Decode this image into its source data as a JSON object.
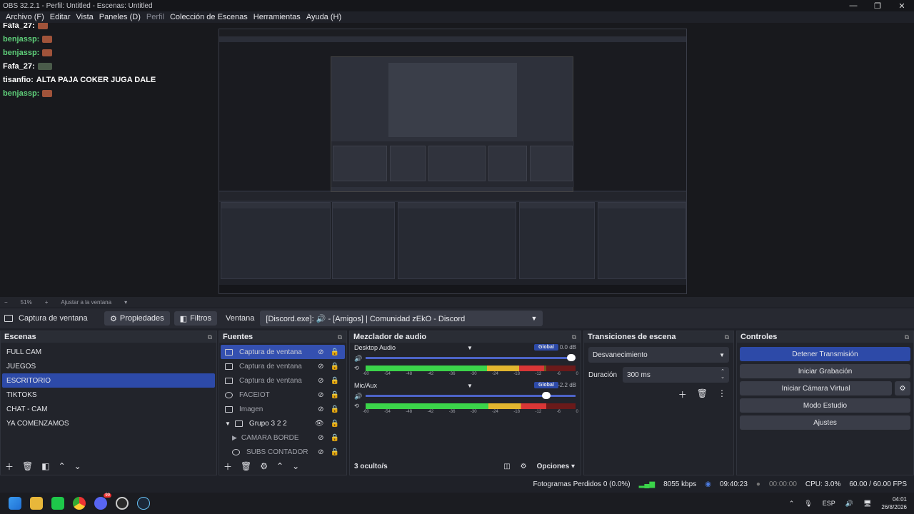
{
  "window": {
    "title": "OBS 32.2.1 - Perfil: Untitled - Escenas: Untitled"
  },
  "menu": {
    "items": [
      "Archivo (F)",
      "Editar",
      "Vista",
      "Paneles (D)",
      "Perfil",
      "Colección de Escenas",
      "Herramientas",
      "Ayuda (H)"
    ],
    "disabled_index": 4
  },
  "chat": {
    "lines": [
      {
        "user": "Fafa_27:",
        "color": "white",
        "text": "",
        "emote": "red",
        "badge": true
      },
      {
        "user": "benjassp:",
        "color": "green",
        "text": "",
        "emote": "red"
      },
      {
        "user": "benjassp:",
        "color": "green",
        "text": "",
        "emote": "red"
      },
      {
        "user": "Fafa_27:",
        "color": "white",
        "text": "",
        "emote": "dark",
        "badge": true
      },
      {
        "user": "tisanfio:",
        "color": "white",
        "text": "ALTA PAJA COKER JUGA DALE",
        "emote": ""
      },
      {
        "user": "benjassp:",
        "color": "green",
        "text": "",
        "emote": "red"
      }
    ]
  },
  "zoombar": {
    "minus": "−",
    "zoom": "51%",
    "plus": "+",
    "fit": "Ajustar a la ventana",
    "dropdown": "▾"
  },
  "context": {
    "source_name": "Captura de ventana",
    "properties": "Propiedades",
    "filters": "Filtros",
    "window_label": "Ventana",
    "window_value": "[Discord.exe]: 🔊 - [Amigos] | Comunidad zEkO - Discord"
  },
  "scenes": {
    "title": "Escenas",
    "items": [
      "FULL CAM",
      "JUEGOS",
      "ESCRITORIO",
      "TIKTOKS",
      "CHAT - CAM",
      "YA COMENZAMOS"
    ],
    "active_index": 2
  },
  "sources": {
    "title": "Fuentes",
    "items": [
      {
        "name": "Captura de ventana",
        "icon": "window-icon",
        "active": true
      },
      {
        "name": "Captura de ventana",
        "icon": "window-icon",
        "active": false
      },
      {
        "name": "Captura de ventana",
        "icon": "window-icon",
        "active": false
      },
      {
        "name": "FACEIOT",
        "icon": "globe-icon",
        "active": false
      },
      {
        "name": "Imagen",
        "icon": "image-icon",
        "active": false
      },
      {
        "name": "Grupo 3 2 2",
        "icon": "folder-icon",
        "active": false,
        "visible": true
      },
      {
        "name": "CAMARA BORDE",
        "icon": "play-icon",
        "active": false
      },
      {
        "name": "SUBS CONTADOR",
        "icon": "globe-icon",
        "active": false
      }
    ]
  },
  "mixer": {
    "title": "Mezclador de audio",
    "tracks": [
      {
        "name": "Desktop Audio",
        "db": "0.0 dB",
        "volume": 1.0,
        "level": 0.85,
        "global": "Global"
      },
      {
        "name": "Mic/Aux",
        "db": "-2.2 dB",
        "volume": 0.88,
        "level": 0.86,
        "global": "Global"
      }
    ],
    "ticks": [
      "-60",
      "-54",
      "-48",
      "-42",
      "-36",
      "-30",
      "-24",
      "-18",
      "-12",
      "-6",
      "0"
    ],
    "hidden_count": "3 oculto/s",
    "options": "Opciones"
  },
  "transitions": {
    "title": "Transiciones de escena",
    "type": "Desvanecimiento",
    "duration_label": "Duración",
    "duration_value": "300 ms"
  },
  "controls": {
    "title": "Controles",
    "buttons": [
      "Detener Transmisión",
      "Iniciar Grabación",
      "Iniciar Cámara Virtual",
      "Modo Estudio",
      "Ajustes"
    ]
  },
  "status": {
    "dropped": "Fotogramas Perdidos 0 (0.0%)",
    "bitrate": "8055 kbps",
    "stream_time": "09:40:23",
    "rec_time": "00:00:00",
    "cpu": "CPU: 3.0%",
    "fps": "60.00 / 60.00 FPS"
  },
  "taskbar": {
    "lang": "ESP",
    "time": "04:01",
    "date": "26/8/2026",
    "discord_badge": "99"
  },
  "colors": {
    "accent": "#2d4aa8",
    "background": "#1f2128",
    "panel": "#22242b"
  }
}
